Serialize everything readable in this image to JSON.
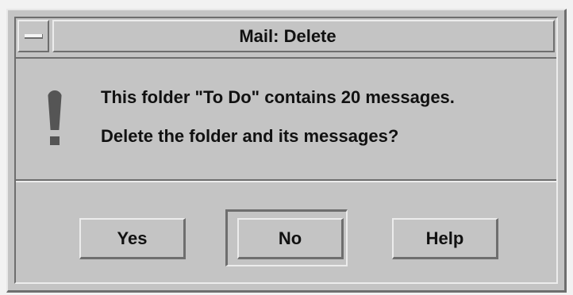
{
  "window": {
    "title": "Mail: Delete"
  },
  "message": {
    "icon": "exclamation-icon",
    "line1": "This folder \"To Do\" contains 20 messages.",
    "line2": "Delete the folder and its messages?"
  },
  "buttons": {
    "yes": "Yes",
    "no": "No",
    "help": "Help",
    "default": "No"
  },
  "colors": {
    "background": "#c4c4c4",
    "shadow": "#6e6e6e",
    "highlight": "#ececec",
    "text": "#111111"
  }
}
